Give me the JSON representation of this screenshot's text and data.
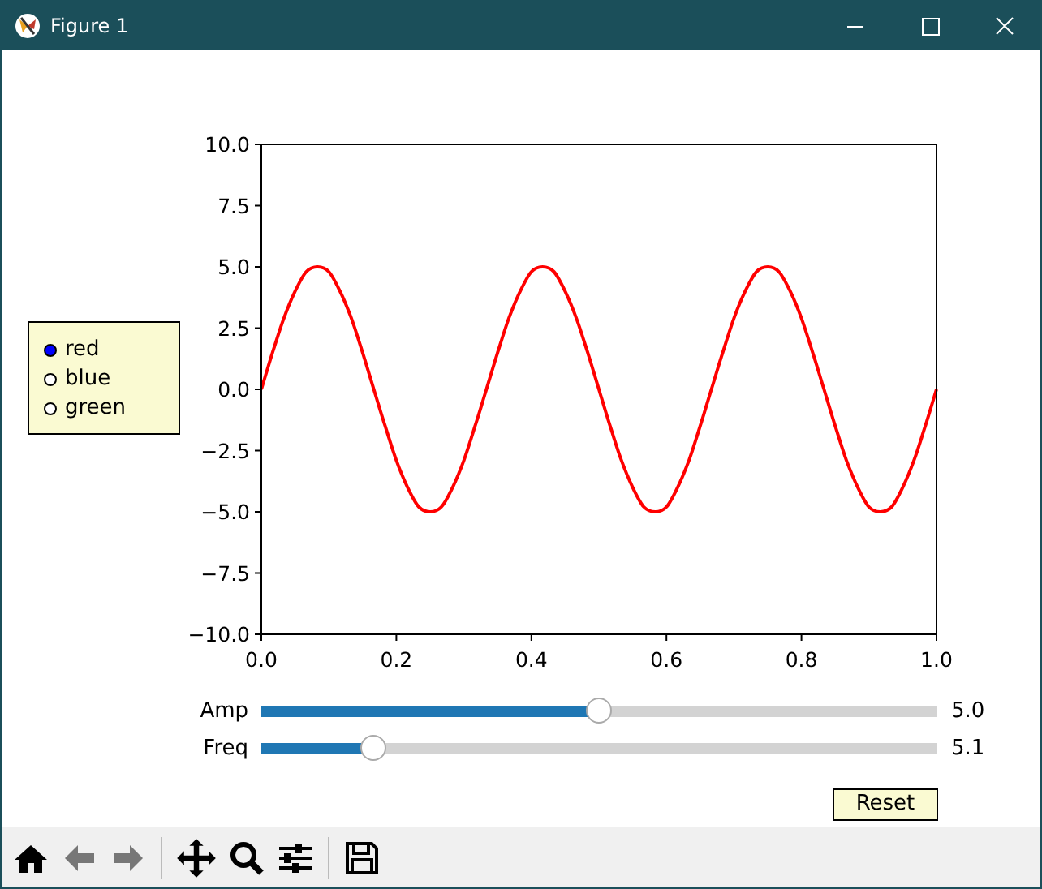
{
  "window": {
    "title": "Figure 1"
  },
  "radio": {
    "options": [
      {
        "label": "red",
        "selected": true
      },
      {
        "label": "blue",
        "selected": false
      },
      {
        "label": "green",
        "selected": false
      }
    ]
  },
  "chart_data": {
    "type": "line",
    "x": [
      0,
      0.0167,
      0.0333,
      0.05,
      0.0667,
      0.0833,
      0.1,
      0.1167,
      0.1333,
      0.15,
      0.1667,
      0.1833,
      0.2,
      0.2167,
      0.2333,
      0.25,
      0.2667,
      0.2833,
      0.3,
      0.3167,
      0.3333,
      0.35,
      0.3667,
      0.3833,
      0.4,
      0.4167,
      0.4333,
      0.45,
      0.4667,
      0.4833,
      0.5,
      0.5167,
      0.5333,
      0.55,
      0.5667,
      0.5833,
      0.6,
      0.6167,
      0.6333,
      0.65,
      0.6667,
      0.6833,
      0.7,
      0.7167,
      0.7333,
      0.75,
      0.7667,
      0.7833,
      0.8,
      0.8167,
      0.8333,
      0.85,
      0.8667,
      0.8833,
      0.9,
      0.9167,
      0.9333,
      0.95,
      0.9667,
      0.9833,
      1
    ],
    "series": [
      {
        "color": "#ff0000",
        "values": [
          0,
          1.5,
          2.9,
          4,
          4.8,
          5,
          4.8,
          4,
          2.9,
          1.5,
          0,
          -1.5,
          -2.9,
          -4,
          -4.8,
          -5,
          -4.8,
          -4,
          -2.9,
          -1.5,
          0,
          1.5,
          2.9,
          4,
          4.8,
          5,
          4.8,
          4,
          2.9,
          1.5,
          0,
          -1.5,
          -2.9,
          -4,
          -4.8,
          -5,
          -4.8,
          -4,
          -2.9,
          -1.5,
          0,
          1.5,
          2.9,
          4,
          4.8,
          5,
          4.8,
          4,
          2.9,
          1.5,
          0,
          -1.5,
          -2.9,
          -4,
          -4.8,
          -5,
          -4.8,
          -4,
          -2.9,
          -1.5,
          0
        ]
      }
    ],
    "xlim": [
      0,
      1
    ],
    "ylim": [
      -10,
      10
    ],
    "xticks": [
      {
        "value": 0,
        "label": "0.0"
      },
      {
        "value": 0.2,
        "label": "0.2"
      },
      {
        "value": 0.4,
        "label": "0.4"
      },
      {
        "value": 0.6,
        "label": "0.6"
      },
      {
        "value": 0.8,
        "label": "0.8"
      },
      {
        "value": 1,
        "label": "1.0"
      }
    ],
    "yticks": [
      {
        "value": -10,
        "label": "−10.0"
      },
      {
        "value": -7.5,
        "label": "−7.5"
      },
      {
        "value": -5,
        "label": "−5.0"
      },
      {
        "value": -2.5,
        "label": "−2.5"
      },
      {
        "value": 0,
        "label": "0.0"
      },
      {
        "value": 2.5,
        "label": "2.5"
      },
      {
        "value": 5,
        "label": "5.0"
      },
      {
        "value": 7.5,
        "label": "7.5"
      },
      {
        "value": 10,
        "label": "10.0"
      }
    ]
  },
  "sliders": [
    {
      "label": "Amp",
      "level": 0.5,
      "reading": "5.0"
    },
    {
      "label": "Freq",
      "level": 0.167,
      "reading": "5.1"
    }
  ],
  "reset_button": {
    "label": "Reset"
  }
}
